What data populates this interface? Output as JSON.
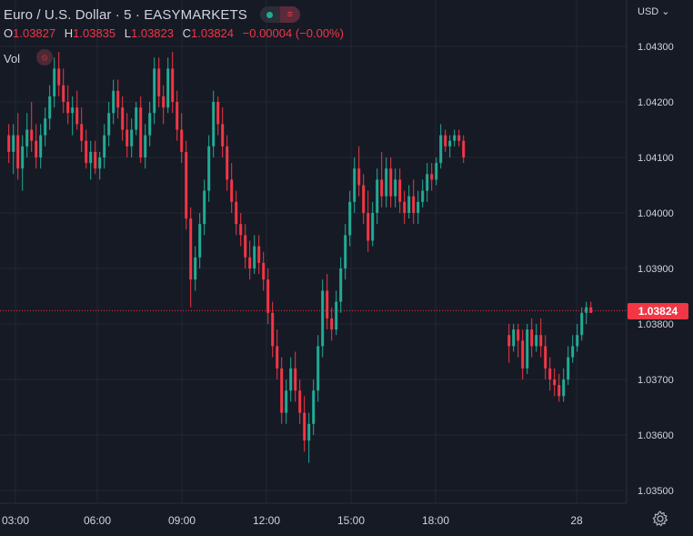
{
  "header": {
    "title": "Euro / U.S. Dollar · 5 · EASYMARKETS",
    "ohlc": {
      "open_label": "O",
      "open": "1.03827",
      "high_label": "H",
      "high": "1.03835",
      "low_label": "L",
      "low": "1.03823",
      "close_label": "C",
      "close": "1.03824",
      "change": "−0.00004 (−0.00%)"
    },
    "status_red_glyph": "≡"
  },
  "volume": {
    "label": "Vol",
    "marker_glyph": "⦸"
  },
  "currency": "USD ⌄",
  "last_price_tag": "1.03824",
  "colors": {
    "background": "#161a25",
    "grid": "#232734",
    "up": "#22ab94",
    "down": "#f23645",
    "text": "#d1d4dc"
  },
  "icons": {
    "settings": "gear-icon",
    "status": "market-open-dot-icon"
  },
  "chart_data": {
    "type": "candlestick",
    "y_ticks": [
      "1.04300",
      "1.04200",
      "1.04100",
      "1.04000",
      "1.03900",
      "1.03800",
      "1.03700",
      "1.03600",
      "1.03500"
    ],
    "x_ticks": [
      "03:00",
      "06:00",
      "09:00",
      "12:00",
      "15:00",
      "18:00",
      "28"
    ],
    "ylim": [
      1.0349,
      1.0438
    ],
    "last_price": 1.03824,
    "grid": true,
    "candles": [
      [
        1.0414,
        1.0416,
        1.0409,
        1.0411
      ],
      [
        1.0411,
        1.0416,
        1.0407,
        1.0414
      ],
      [
        1.0414,
        1.0418,
        1.0406,
        1.0408
      ],
      [
        1.0408,
        1.0414,
        1.0404,
        1.0412
      ],
      [
        1.0412,
        1.0418,
        1.041,
        1.0415
      ],
      [
        1.0415,
        1.042,
        1.0411,
        1.0413
      ],
      [
        1.0413,
        1.0416,
        1.0408,
        1.041
      ],
      [
        1.041,
        1.0416,
        1.0408,
        1.0414
      ],
      [
        1.0414,
        1.0419,
        1.0412,
        1.0417
      ],
      [
        1.0417,
        1.0423,
        1.0415,
        1.0421
      ],
      [
        1.0421,
        1.0428,
        1.0419,
        1.0426
      ],
      [
        1.0426,
        1.0429,
        1.0421,
        1.0423
      ],
      [
        1.0423,
        1.0426,
        1.0418,
        1.042
      ],
      [
        1.042,
        1.0423,
        1.0416,
        1.0418
      ],
      [
        1.0418,
        1.0421,
        1.0414,
        1.0419
      ],
      [
        1.0419,
        1.0422,
        1.0415,
        1.0416
      ],
      [
        1.0416,
        1.0419,
        1.0411,
        1.0413
      ],
      [
        1.0413,
        1.0415,
        1.0408,
        1.0409
      ],
      [
        1.0409,
        1.0413,
        1.0406,
        1.0411
      ],
      [
        1.0411,
        1.0413,
        1.0407,
        1.0408
      ],
      [
        1.0408,
        1.0411,
        1.0406,
        1.041
      ],
      [
        1.041,
        1.0416,
        1.0408,
        1.0414
      ],
      [
        1.0414,
        1.042,
        1.0412,
        1.0418
      ],
      [
        1.0418,
        1.0424,
        1.0416,
        1.0422
      ],
      [
        1.0422,
        1.0424,
        1.0417,
        1.0419
      ],
      [
        1.0419,
        1.0421,
        1.0413,
        1.0415
      ],
      [
        1.0415,
        1.0418,
        1.041,
        1.0412
      ],
      [
        1.0412,
        1.0417,
        1.041,
        1.0415
      ],
      [
        1.0415,
        1.042,
        1.0414,
        1.0419
      ],
      [
        1.0419,
        1.0421,
        1.0409,
        1.041
      ],
      [
        1.041,
        1.0416,
        1.0408,
        1.0414
      ],
      [
        1.0414,
        1.042,
        1.0412,
        1.0418
      ],
      [
        1.0418,
        1.0428,
        1.0416,
        1.0426
      ],
      [
        1.0426,
        1.0428,
        1.0419,
        1.0421
      ],
      [
        1.0421,
        1.0423,
        1.0416,
        1.0419
      ],
      [
        1.0419,
        1.0428,
        1.0418,
        1.0426
      ],
      [
        1.0426,
        1.0429,
        1.0418,
        1.042
      ],
      [
        1.042,
        1.0422,
        1.0413,
        1.0415
      ],
      [
        1.0415,
        1.0418,
        1.0409,
        1.0411
      ],
      [
        1.0411,
        1.0413,
        1.0397,
        1.0399
      ],
      [
        1.0399,
        1.0401,
        1.0383,
        1.0388
      ],
      [
        1.0388,
        1.0394,
        1.0386,
        1.0392
      ],
      [
        1.0392,
        1.04,
        1.039,
        1.0398
      ],
      [
        1.0398,
        1.0406,
        1.0396,
        1.0404
      ],
      [
        1.0404,
        1.0414,
        1.0402,
        1.0412
      ],
      [
        1.0412,
        1.0422,
        1.041,
        1.042
      ],
      [
        1.042,
        1.0421,
        1.0414,
        1.0416
      ],
      [
        1.0416,
        1.0419,
        1.041,
        1.0412
      ],
      [
        1.0412,
        1.0414,
        1.0404,
        1.0406
      ],
      [
        1.0406,
        1.0409,
        1.04,
        1.0402
      ],
      [
        1.0402,
        1.0404,
        1.0396,
        1.0398
      ],
      [
        1.0398,
        1.04,
        1.0394,
        1.0396
      ],
      [
        1.0396,
        1.0398,
        1.039,
        1.0392
      ],
      [
        1.0392,
        1.0395,
        1.0388,
        1.039
      ],
      [
        1.039,
        1.0396,
        1.0389,
        1.0394
      ],
      [
        1.0394,
        1.0396,
        1.0389,
        1.0391
      ],
      [
        1.0391,
        1.0393,
        1.0386,
        1.0388
      ],
      [
        1.0388,
        1.039,
        1.038,
        1.0382
      ],
      [
        1.0382,
        1.0384,
        1.0374,
        1.0376
      ],
      [
        1.0376,
        1.0379,
        1.037,
        1.0372
      ],
      [
        1.0372,
        1.0374,
        1.0362,
        1.0364
      ],
      [
        1.0364,
        1.037,
        1.0362,
        1.0368
      ],
      [
        1.0368,
        1.0374,
        1.0366,
        1.0372
      ],
      [
        1.0372,
        1.0375,
        1.0366,
        1.0368
      ],
      [
        1.0368,
        1.037,
        1.0362,
        1.0364
      ],
      [
        1.0364,
        1.0367,
        1.0357,
        1.0359
      ],
      [
        1.0359,
        1.0364,
        1.0355,
        1.0362
      ],
      [
        1.0362,
        1.037,
        1.036,
        1.0368
      ],
      [
        1.0368,
        1.0378,
        1.0366,
        1.0376
      ],
      [
        1.0376,
        1.0388,
        1.0374,
        1.0386
      ],
      [
        1.0386,
        1.0389,
        1.0379,
        1.0381
      ],
      [
        1.0381,
        1.0383,
        1.0377,
        1.0379
      ],
      [
        1.0379,
        1.0386,
        1.0378,
        1.0384
      ],
      [
        1.0384,
        1.0392,
        1.0382,
        1.039
      ],
      [
        1.039,
        1.0398,
        1.0388,
        1.0396
      ],
      [
        1.0396,
        1.0404,
        1.0394,
        1.0402
      ],
      [
        1.0402,
        1.041,
        1.04,
        1.0408
      ],
      [
        1.0408,
        1.0412,
        1.0403,
        1.0405
      ],
      [
        1.0405,
        1.0407,
        1.0398,
        1.04
      ],
      [
        1.04,
        1.0404,
        1.0393,
        1.0395
      ],
      [
        1.0395,
        1.0402,
        1.0394,
        1.04
      ],
      [
        1.04,
        1.0408,
        1.0398,
        1.0406
      ],
      [
        1.0406,
        1.0411,
        1.0401,
        1.0403
      ],
      [
        1.0403,
        1.041,
        1.0401,
        1.0408
      ],
      [
        1.0408,
        1.041,
        1.0401,
        1.0403
      ],
      [
        1.0403,
        1.0408,
        1.0401,
        1.0406
      ],
      [
        1.0406,
        1.0408,
        1.04,
        1.0402
      ],
      [
        1.0402,
        1.0404,
        1.0398,
        1.04
      ],
      [
        1.04,
        1.0405,
        1.0399,
        1.0403
      ],
      [
        1.0403,
        1.0406,
        1.0398,
        1.04
      ],
      [
        1.04,
        1.0404,
        1.0398,
        1.0402
      ],
      [
        1.0402,
        1.0406,
        1.0401,
        1.0404
      ],
      [
        1.0404,
        1.0409,
        1.0402,
        1.0407
      ],
      [
        1.0407,
        1.0409,
        1.0404,
        1.0406
      ],
      [
        1.0406,
        1.041,
        1.0405,
        1.0409
      ],
      [
        1.0409,
        1.0416,
        1.0408,
        1.0414
      ],
      [
        1.0414,
        1.0415,
        1.0411,
        1.0412
      ],
      [
        1.0412,
        1.0414,
        1.041,
        1.0413
      ],
      [
        1.0413,
        1.0415,
        1.0412,
        1.0414
      ],
      [
        1.0414,
        1.0415,
        1.0412,
        1.0413
      ],
      [
        1.0413,
        1.0414,
        1.0409,
        1.041
      ],
      null,
      null,
      null,
      null,
      null,
      null,
      null,
      null,
      null,
      [
        1.0378,
        1.038,
        1.0373,
        1.0376
      ],
      [
        1.0376,
        1.038,
        1.0375,
        1.0379
      ],
      [
        1.0379,
        1.038,
        1.0374,
        1.0377
      ],
      [
        1.0377,
        1.0379,
        1.037,
        1.0372
      ],
      [
        1.0372,
        1.038,
        1.0371,
        1.0379
      ],
      [
        1.0379,
        1.0381,
        1.0374,
        1.0376
      ],
      [
        1.0376,
        1.038,
        1.0375,
        1.0378
      ],
      [
        1.0378,
        1.0381,
        1.0374,
        1.0376
      ],
      [
        1.0376,
        1.0378,
        1.037,
        1.0372
      ],
      [
        1.0372,
        1.0374,
        1.0368,
        1.037
      ],
      [
        1.037,
        1.0372,
        1.0367,
        1.0369
      ],
      [
        1.0369,
        1.0371,
        1.0366,
        1.0367
      ],
      [
        1.0367,
        1.0372,
        1.0366,
        1.037
      ],
      [
        1.037,
        1.0376,
        1.0369,
        1.0374
      ],
      [
        1.0374,
        1.0378,
        1.0373,
        1.0376
      ],
      [
        1.0376,
        1.038,
        1.0375,
        1.0378
      ],
      [
        1.0378,
        1.0383,
        1.0377,
        1.0382
      ],
      [
        1.0382,
        1.0384,
        1.038,
        1.0383
      ],
      [
        1.0383,
        1.0384,
        1.0382,
        1.0382
      ]
    ]
  }
}
